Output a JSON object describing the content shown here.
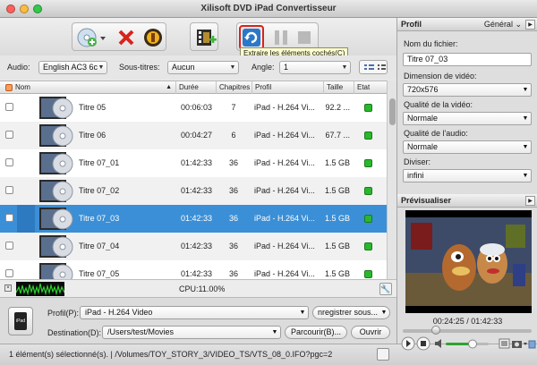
{
  "window": {
    "title": "Xilisoft DVD iPad Convertisseur"
  },
  "toolbar": {
    "buttons": [
      "add-file",
      "delete",
      "properties",
      "add-clip",
      "extract",
      "pause",
      "stop"
    ],
    "tooltip": "Extraire les éléments cochés(C)"
  },
  "options": {
    "audio_label": "Audio:",
    "audio_value": "English AC3 6c",
    "subtitles_label": "Sous-titres:",
    "subtitles_value": "Aucun",
    "angle_label": "Angle:",
    "angle_value": "1"
  },
  "table": {
    "columns": [
      "Nom",
      "Durée",
      "Chapitres",
      "Profil",
      "Taille",
      "Etat"
    ],
    "rows": [
      {
        "name": "Titre 05",
        "duration": "00:06:03",
        "chapters": "7",
        "profile": "iPad - H.264 Vi...",
        "size": "92.2 ...",
        "checked": false,
        "selected": false
      },
      {
        "name": "Titre 06",
        "duration": "00:04:27",
        "chapters": "6",
        "profile": "iPad - H.264 Vi...",
        "size": "67.7 ...",
        "checked": false,
        "selected": false
      },
      {
        "name": "Titre 07_01",
        "duration": "01:42:33",
        "chapters": "36",
        "profile": "iPad - H.264 Vi...",
        "size": "1.5 GB",
        "checked": false,
        "selected": false
      },
      {
        "name": "Titre 07_02",
        "duration": "01:42:33",
        "chapters": "36",
        "profile": "iPad - H.264 Vi...",
        "size": "1.5 GB",
        "checked": false,
        "selected": false
      },
      {
        "name": "Titre 07_03",
        "duration": "01:42:33",
        "chapters": "36",
        "profile": "iPad - H.264 Vi...",
        "size": "1.5 GB",
        "checked": false,
        "selected": true
      },
      {
        "name": "Titre 07_04",
        "duration": "01:42:33",
        "chapters": "36",
        "profile": "iPad - H.264 Vi...",
        "size": "1.5 GB",
        "checked": false,
        "selected": false
      },
      {
        "name": "Titre 07_05",
        "duration": "01:42:33",
        "chapters": "36",
        "profile": "iPad - H.264 Vi...",
        "size": "1.5 GB",
        "checked": false,
        "selected": false
      }
    ]
  },
  "cpu": {
    "text": "CPU:11.00%"
  },
  "output": {
    "device_label": "iPad",
    "profile_label": "Profil(P):",
    "profile_value": "iPad - H.264 Video",
    "save_as_label": "nregistrer sous...",
    "destination_label": "Destination(D):",
    "destination_value": "/Users/test/Movies",
    "browse_label": "Parcourir(B)...",
    "open_label": "Ouvrir"
  },
  "status": {
    "text": "1 élément(s) sélectionné(s). | /Volumes/TOY_STORY_3/VIDEO_TS/VTS_08_0.IFO?pgc=2"
  },
  "profile_panel": {
    "title": "Profil",
    "mode": "Général",
    "filename_label": "Nom du fichier:",
    "filename_value": "Titre 07_03",
    "dimension_label": "Dimension de vidéo:",
    "dimension_value": "720x576",
    "video_quality_label": "Qualité de la vidéo:",
    "video_quality_value": "Normale",
    "audio_quality_label": "Qualité de l'audio:",
    "audio_quality_value": "Normale",
    "split_label": "Diviser:",
    "split_value": "infini"
  },
  "preview_panel": {
    "title": "Prévisualiser",
    "time": "00:24:25 / 01:42:33",
    "progress": 0.238
  },
  "colors": {
    "accent": "#3b8fd6",
    "status_ok": "#29b82c"
  }
}
